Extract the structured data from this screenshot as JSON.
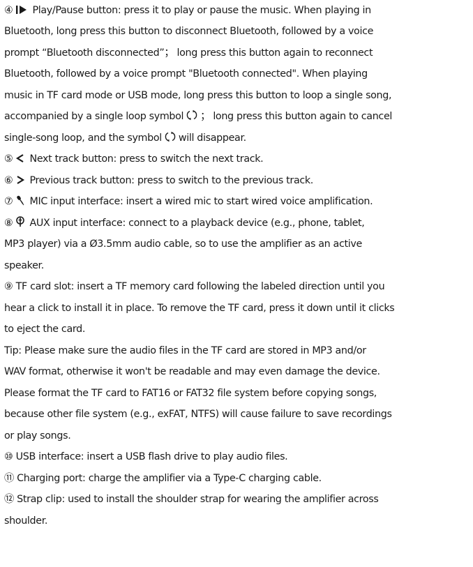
{
  "items": {
    "play_pause": {
      "num": "④",
      "line1": "Play/Pause button: press it to play or pause the music. When playing in",
      "line2": "Bluetooth, long press this button to disconnect Bluetooth, followed by a voice",
      "line3": "prompt “Bluetooth disconnected”； long press this button again to reconnect",
      "line4": "Bluetooth, followed by a voice prompt \"Bluetooth connected\". When playing",
      "line5": "music in TF card mode or USB mode, long press this button to loop a single song,",
      "line6a": "accompanied by a single loop symbol",
      "line6b": "； long press this button again to cancel",
      "line7a": "single-song loop, and the symbol",
      "line7b": "will disappear."
    },
    "next_track": {
      "num": "⑤",
      "text": "Next track button: press to switch the next track."
    },
    "prev_track": {
      "num": "⑥",
      "text": "Previous track button: press to switch to the previous track."
    },
    "mic": {
      "num": "⑦",
      "text": "MIC input interface: insert a wired mic to start wired voice amplification."
    },
    "aux": {
      "num": "⑧",
      "line1": "AUX input interface: connect to a playback device (e.g., phone, tablet,",
      "line2": "MP3 player) via a Ø3.5mm audio cable, so to use the amplifier as an active",
      "line3": "speaker."
    },
    "tf_slot": {
      "line1": "⑨ TF card slot: insert a TF memory card following the labeled direction until you",
      "line2": "hear a click to install it in place. To remove the TF card, press it down until it clicks",
      "line3": "to eject the card."
    },
    "tip": {
      "line1": "Tip: Please make sure the audio files in the TF card are stored in MP3 and/or",
      "line2": "WAV format, otherwise it won't be readable and may even damage the device.",
      "line3": "Please format the TF card to FAT16 or FAT32 file system before copying songs,",
      "line4": "because other file system (e.g., exFAT, NTFS) will cause failure to save recordings",
      "line5": "or play songs."
    },
    "usb": {
      "text": "⑩ USB interface: insert a USB flash drive to play audio files."
    },
    "charging": {
      "text": "⑪  Charging port: charge the amplifier via a Type-C charging cable."
    },
    "strap": {
      "line1": "⑫  Strap clip: used to install the shoulder strap for wearing the amplifier across",
      "line2": "shoulder."
    }
  },
  "icons": {
    "play_pause": "play-pause-icon",
    "next": "chevron-left-icon",
    "previous": "chevron-right-icon",
    "mic": "microphone-icon",
    "aux": "aux-jack-icon",
    "loop": "loop-icon"
  }
}
